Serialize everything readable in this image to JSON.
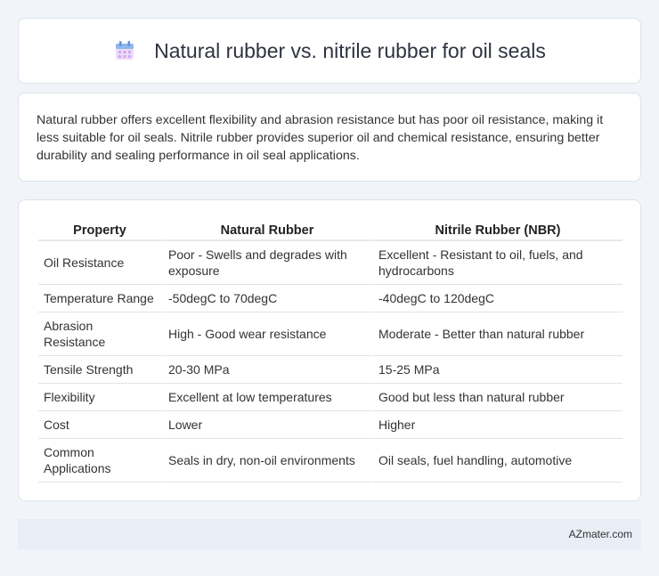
{
  "header": {
    "title": "Natural rubber vs. nitrile rubber for oil seals",
    "icon": "calendar-icon",
    "icon_colors": {
      "ring": "#6aa0e8",
      "body": "#e9dcf5",
      "grid": "#d7b3ef"
    }
  },
  "intro": {
    "text": "Natural rubber offers excellent flexibility and abrasion resistance but has poor oil resistance, making it less suitable for oil seals. Nitrile rubber provides superior oil and chemical resistance, ensuring better durability and sealing performance in oil seal applications."
  },
  "table": {
    "headers": [
      "Property",
      "Natural Rubber",
      "Nitrile Rubber (NBR)"
    ],
    "rows": [
      [
        "Oil Resistance",
        "Poor - Swells and degrades with exposure",
        "Excellent - Resistant to oil, fuels, and hydrocarbons"
      ],
      [
        "Temperature Range",
        "-50degC to 70degC",
        "-40degC to 120degC"
      ],
      [
        "Abrasion Resistance",
        "High - Good wear resistance",
        "Moderate - Better than natural rubber"
      ],
      [
        "Tensile Strength",
        "20-30 MPa",
        "15-25 MPa"
      ],
      [
        "Flexibility",
        "Excellent at low temperatures",
        "Good but less than natural rubber"
      ],
      [
        "Cost",
        "Lower",
        "Higher"
      ],
      [
        "Common Applications",
        "Seals in dry, non-oil environments",
        "Oil seals, fuel handling, automotive"
      ]
    ]
  },
  "footer": {
    "text": "AZmater.com"
  }
}
